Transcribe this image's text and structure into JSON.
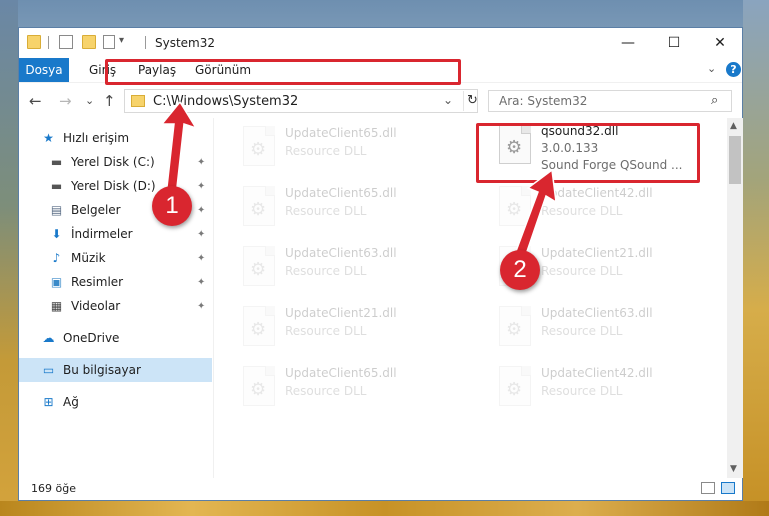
{
  "window": {
    "title": "System32",
    "minimize_glyph": "—",
    "maximize_glyph": "☐",
    "close_glyph": "✕"
  },
  "ribbon": {
    "file_tab": "Dosya",
    "tabs": [
      "Giriş",
      "Paylaş",
      "Görünüm"
    ],
    "help_glyph": "?",
    "collapse_glyph": "⌄"
  },
  "address": {
    "path": "C:\\Windows\\System32",
    "back_glyph": "←",
    "forward_glyph": "→",
    "recent_glyph": "⌄",
    "up_glyph": "↑",
    "dropdown_glyph": "⌄",
    "refresh_glyph": "↻"
  },
  "search": {
    "placeholder": "Ara: System32",
    "icon_glyph": "⌕"
  },
  "sidebar": {
    "items": [
      {
        "label": "Hızlı erişim",
        "icon": "star-icon",
        "glyph": "★",
        "pinned": false
      },
      {
        "label": "Yerel Disk (C:)",
        "icon": "drive-icon",
        "glyph": "▬",
        "pinned": true
      },
      {
        "label": "Yerel Disk (D:)",
        "icon": "drive-icon",
        "glyph": "▬",
        "pinned": true
      },
      {
        "label": "Belgeler",
        "icon": "documents-icon",
        "glyph": "▤",
        "pinned": true
      },
      {
        "label": "İndirmeler",
        "icon": "download-icon",
        "glyph": "⬇",
        "pinned": true
      },
      {
        "label": "Müzik",
        "icon": "music-icon",
        "glyph": "♪",
        "pinned": true
      },
      {
        "label": "Resimler",
        "icon": "pictures-icon",
        "glyph": "▣",
        "pinned": true
      },
      {
        "label": "Videolar",
        "icon": "videos-icon",
        "glyph": "▦",
        "pinned": true
      },
      {
        "label": "OneDrive",
        "icon": "cloud-icon",
        "glyph": "☁",
        "pinned": false
      },
      {
        "label": "Bu bilgisayar",
        "icon": "computer-icon",
        "glyph": "▭",
        "pinned": false
      },
      {
        "label": "Ağ",
        "icon": "network-icon",
        "glyph": "⊞",
        "pinned": false
      }
    ],
    "pin_glyph": "✦"
  },
  "files": {
    "left_column": [
      {
        "name": "UpdateClient65.dll",
        "desc": "Resource DLL"
      },
      {
        "name": "UpdateClient65.dll",
        "desc": "Resource DLL"
      },
      {
        "name": "UpdateClient63.dll",
        "desc": "Resource DLL"
      },
      {
        "name": "UpdateClient21.dll",
        "desc": "Resource DLL"
      },
      {
        "name": "UpdateClient65.dll",
        "desc": "Resource DLL"
      }
    ],
    "highlighted": {
      "name": "qsound32.dll",
      "version": "3.0.0.133",
      "desc": "Sound Forge QSound ..."
    },
    "right_column": [
      {
        "name": "UpdateClient42.dll",
        "desc": "Resource DLL"
      },
      {
        "name": "UpdateClient21.dll",
        "desc": "Resource DLL"
      },
      {
        "name": "UpdateClient63.dll",
        "desc": "Resource DLL"
      },
      {
        "name": "UpdateClient42.dll",
        "desc": "Resource DLL"
      }
    ],
    "gear_glyph": "⚙"
  },
  "status": {
    "count": "169 öğe"
  },
  "annotations": {
    "step1": "1",
    "step2": "2",
    "color": "#d9262f"
  },
  "colors": {
    "accent": "#1979ca",
    "selection": "#cce4f7"
  }
}
